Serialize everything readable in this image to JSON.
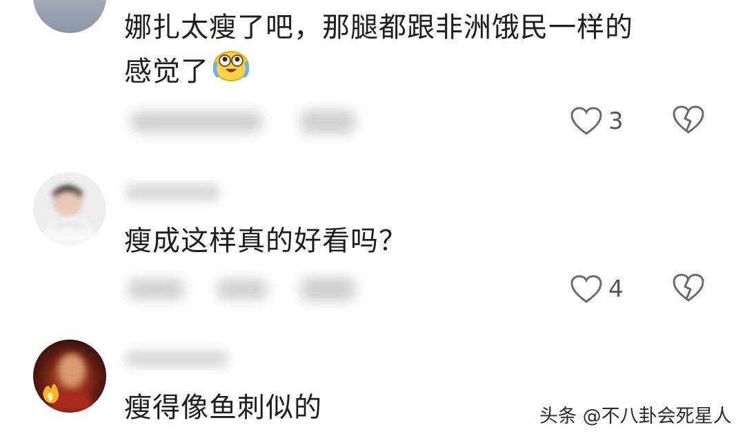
{
  "comments": [
    {
      "text_line1": "娜扎太瘦了吧，那腿都跟非洲饿民一样的",
      "text_line2": "感觉了",
      "emoji_icon": "laughing-crying-emoji-icon",
      "likes": "3"
    },
    {
      "text": "瘦成这样真的好看吗？",
      "likes": "4"
    },
    {
      "text": "瘦得像鱼刺似的"
    }
  ],
  "watermark": "头条 @不八卦会死星人",
  "icons": {
    "like": "heart-outline-icon",
    "dislike": "broken-heart-icon"
  },
  "colors": {
    "text": "#1d1d1d",
    "icon": "#6a6a6a",
    "count": "#555555"
  }
}
